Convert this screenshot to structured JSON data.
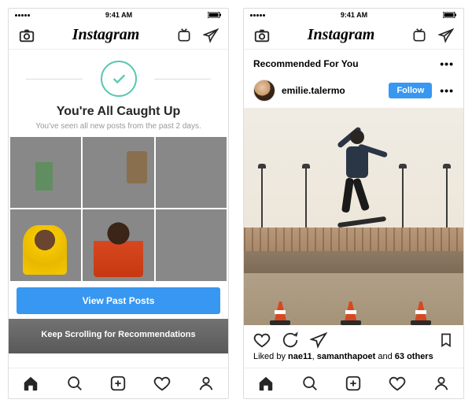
{
  "status": {
    "time": "9:41 AM"
  },
  "header": {
    "logo": "Instagram"
  },
  "caught_up": {
    "title": "You're All Caught Up",
    "subtitle": "You've seen all new posts from the past 2 days.",
    "button": "View Past Posts",
    "scroll_hint": "Keep Scrolling for Recommendations"
  },
  "recommended": {
    "heading": "Recommended For You",
    "username": "emilie.talermo",
    "follow": "Follow",
    "likes_prefix": "Liked by ",
    "liker1": "nae11",
    "comma": ", ",
    "liker2": "samanthapoet",
    "and": " and ",
    "others": "63 others"
  }
}
